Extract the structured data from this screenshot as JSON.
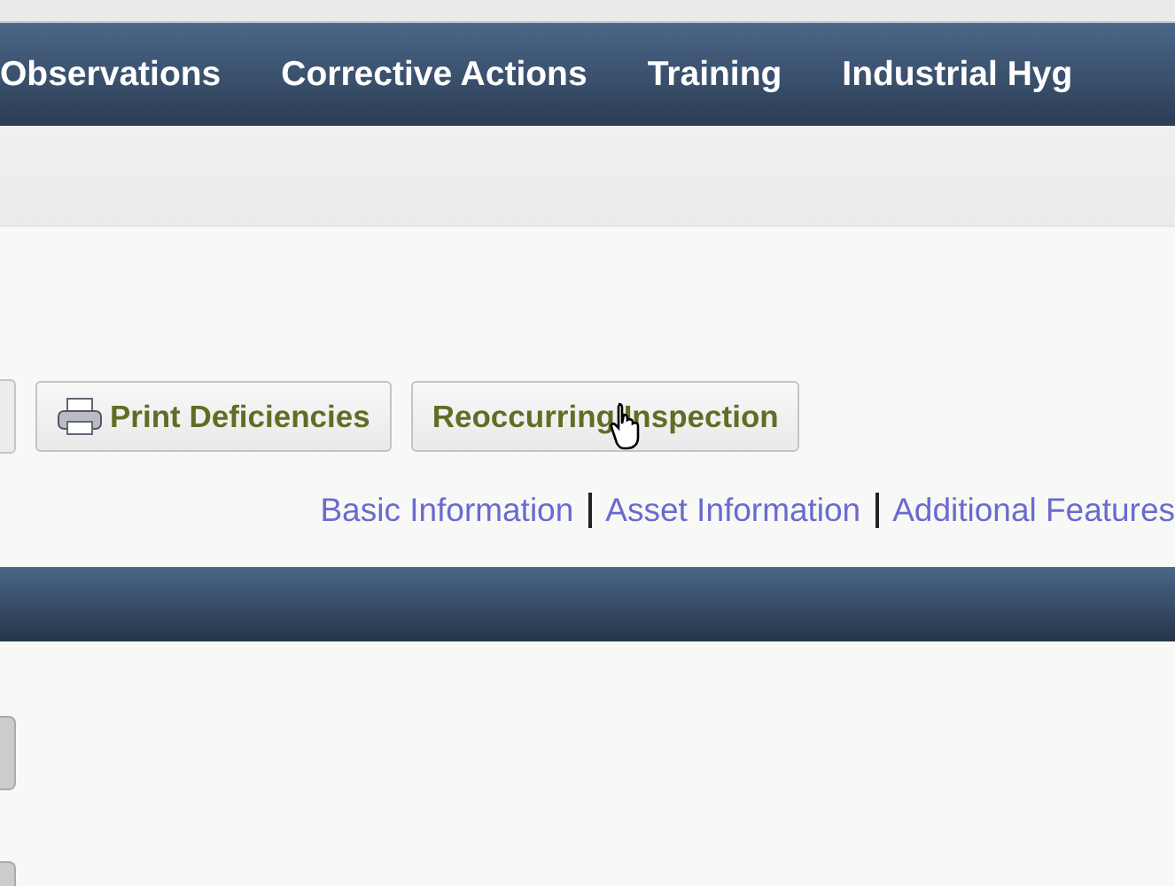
{
  "nav": {
    "items": [
      "Observations",
      "Corrective Actions",
      "Training",
      "Industrial Hyg"
    ]
  },
  "toolbar": {
    "buttons": [
      {
        "label": "Print Deficiencies",
        "kind": "print"
      },
      {
        "label": "Reoccurring Inspection",
        "kind": "plain"
      }
    ]
  },
  "section_links": [
    "Basic Information",
    "Asset Information",
    "Additional Features"
  ]
}
